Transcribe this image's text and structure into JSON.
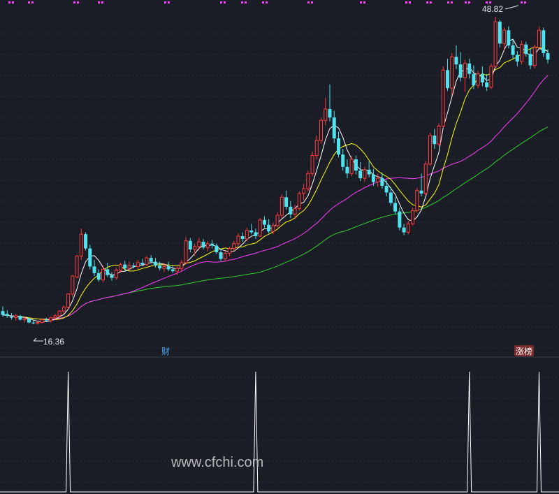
{
  "chart_data": [
    {
      "type": "candlestick",
      "price_range": [
        14.5,
        50.0
      ],
      "annotations": {
        "high_label": "48.82",
        "low_label": "16.36"
      },
      "event_markers": [
        {
          "label": "财",
          "index": 40
        },
        {
          "label": "涨榜",
          "index": 125
        }
      ],
      "colors": {
        "up": "#ff3b3b",
        "down": "#4fe3f0",
        "ma5": "#ffffff",
        "ma10": "#ffff00",
        "ma30": "#ff3cff",
        "ma60": "#2ed12e",
        "dots": "#ff3cff",
        "grid": "#2e3440"
      },
      "candles": [
        {
          "o": 17.8,
          "h": 18.3,
          "l": 17.2,
          "c": 17.4
        },
        {
          "o": 17.5,
          "h": 17.9,
          "l": 17.1,
          "c": 17.3
        },
        {
          "o": 17.2,
          "h": 17.6,
          "l": 16.9,
          "c": 17.1
        },
        {
          "o": 17.1,
          "h": 17.5,
          "l": 16.8,
          "c": 17.3
        },
        {
          "o": 17.3,
          "h": 17.4,
          "l": 16.8,
          "c": 16.9
        },
        {
          "o": 16.9,
          "h": 17.2,
          "l": 16.6,
          "c": 17.0
        },
        {
          "o": 17.0,
          "h": 17.1,
          "l": 16.5,
          "c": 16.6
        },
        {
          "o": 16.6,
          "h": 16.9,
          "l": 16.4,
          "c": 16.5
        },
        {
          "o": 16.5,
          "h": 16.8,
          "l": 16.36,
          "c": 16.6
        },
        {
          "o": 16.6,
          "h": 17.0,
          "l": 16.5,
          "c": 16.9
        },
        {
          "o": 16.9,
          "h": 17.1,
          "l": 16.7,
          "c": 16.8
        },
        {
          "o": 16.8,
          "h": 17.2,
          "l": 16.6,
          "c": 17.1
        },
        {
          "o": 17.1,
          "h": 17.5,
          "l": 16.9,
          "c": 17.3
        },
        {
          "o": 17.3,
          "h": 17.9,
          "l": 17.1,
          "c": 17.8
        },
        {
          "o": 17.8,
          "h": 18.4,
          "l": 17.5,
          "c": 18.2
        },
        {
          "o": 18.2,
          "h": 19.7,
          "l": 18.0,
          "c": 19.6
        },
        {
          "o": 19.6,
          "h": 21.6,
          "l": 19.3,
          "c": 21.5
        },
        {
          "o": 21.4,
          "h": 23.7,
          "l": 21.2,
          "c": 23.6
        },
        {
          "o": 23.6,
          "h": 26.5,
          "l": 23.2,
          "c": 25.9
        },
        {
          "o": 25.9,
          "h": 26.1,
          "l": 24.2,
          "c": 24.4
        },
        {
          "o": 24.4,
          "h": 24.8,
          "l": 22.2,
          "c": 22.5
        },
        {
          "o": 22.5,
          "h": 23.2,
          "l": 21.5,
          "c": 21.8
        },
        {
          "o": 21.8,
          "h": 22.2,
          "l": 20.9,
          "c": 21.1
        },
        {
          "o": 21.1,
          "h": 22.6,
          "l": 20.8,
          "c": 22.2
        },
        {
          "o": 22.2,
          "h": 22.9,
          "l": 21.4,
          "c": 21.6
        },
        {
          "o": 21.6,
          "h": 21.9,
          "l": 21.0,
          "c": 21.3
        },
        {
          "o": 21.3,
          "h": 22.4,
          "l": 21.1,
          "c": 22.1
        },
        {
          "o": 22.1,
          "h": 22.9,
          "l": 21.8,
          "c": 22.7
        },
        {
          "o": 22.7,
          "h": 23.1,
          "l": 22.0,
          "c": 22.3
        },
        {
          "o": 22.3,
          "h": 23.0,
          "l": 22.1,
          "c": 22.6
        },
        {
          "o": 22.6,
          "h": 22.9,
          "l": 22.3,
          "c": 22.5
        },
        {
          "o": 22.5,
          "h": 23.2,
          "l": 22.2,
          "c": 22.9
        },
        {
          "o": 22.9,
          "h": 23.3,
          "l": 22.6,
          "c": 22.7
        },
        {
          "o": 22.7,
          "h": 23.6,
          "l": 22.5,
          "c": 23.4
        },
        {
          "o": 23.4,
          "h": 23.7,
          "l": 22.9,
          "c": 23.0
        },
        {
          "o": 23.0,
          "h": 23.4,
          "l": 22.4,
          "c": 22.6
        },
        {
          "o": 22.6,
          "h": 23.0,
          "l": 22.1,
          "c": 22.3
        },
        {
          "o": 22.3,
          "h": 22.8,
          "l": 21.9,
          "c": 22.5
        },
        {
          "o": 22.5,
          "h": 23.0,
          "l": 22.0,
          "c": 22.2
        },
        {
          "o": 22.2,
          "h": 22.6,
          "l": 21.8,
          "c": 22.0
        },
        {
          "o": 22.0,
          "h": 22.5,
          "l": 21.6,
          "c": 22.3
        },
        {
          "o": 22.3,
          "h": 23.2,
          "l": 22.0,
          "c": 22.9
        },
        {
          "o": 22.9,
          "h": 25.6,
          "l": 22.7,
          "c": 25.2
        },
        {
          "o": 25.2,
          "h": 25.5,
          "l": 24.0,
          "c": 24.3
        },
        {
          "o": 24.3,
          "h": 24.9,
          "l": 23.6,
          "c": 24.6
        },
        {
          "o": 24.6,
          "h": 25.5,
          "l": 24.2,
          "c": 25.1
        },
        {
          "o": 25.1,
          "h": 25.4,
          "l": 24.3,
          "c": 24.5
        },
        {
          "o": 24.5,
          "h": 25.2,
          "l": 24.1,
          "c": 24.9
        },
        {
          "o": 24.9,
          "h": 25.3,
          "l": 24.4,
          "c": 24.7
        },
        {
          "o": 24.7,
          "h": 24.9,
          "l": 23.8,
          "c": 24.0
        },
        {
          "o": 24.0,
          "h": 24.4,
          "l": 23.1,
          "c": 23.3
        },
        {
          "o": 23.3,
          "h": 24.2,
          "l": 23.0,
          "c": 23.9
        },
        {
          "o": 23.9,
          "h": 24.6,
          "l": 23.6,
          "c": 24.4
        },
        {
          "o": 24.4,
          "h": 25.2,
          "l": 24.1,
          "c": 24.9
        },
        {
          "o": 24.9,
          "h": 26.0,
          "l": 24.6,
          "c": 25.7
        },
        {
          "o": 25.7,
          "h": 26.1,
          "l": 25.1,
          "c": 25.4
        },
        {
          "o": 25.4,
          "h": 26.6,
          "l": 25.2,
          "c": 26.3
        },
        {
          "o": 26.3,
          "h": 27.0,
          "l": 25.9,
          "c": 26.1
        },
        {
          "o": 26.1,
          "h": 26.5,
          "l": 25.4,
          "c": 25.7
        },
        {
          "o": 25.7,
          "h": 27.6,
          "l": 25.6,
          "c": 27.4
        },
        {
          "o": 27.4,
          "h": 27.8,
          "l": 26.6,
          "c": 26.9
        },
        {
          "o": 26.9,
          "h": 27.5,
          "l": 26.0,
          "c": 26.2
        },
        {
          "o": 26.2,
          "h": 27.1,
          "l": 25.9,
          "c": 26.8
        },
        {
          "o": 26.8,
          "h": 28.2,
          "l": 26.6,
          "c": 27.9
        },
        {
          "o": 27.9,
          "h": 30.1,
          "l": 27.6,
          "c": 29.8
        },
        {
          "o": 29.8,
          "h": 30.5,
          "l": 28.5,
          "c": 28.8
        },
        {
          "o": 28.8,
          "h": 29.4,
          "l": 27.6,
          "c": 28.0
        },
        {
          "o": 28.0,
          "h": 29.0,
          "l": 27.5,
          "c": 28.6
        },
        {
          "o": 28.6,
          "h": 30.4,
          "l": 28.4,
          "c": 30.2
        },
        {
          "o": 30.2,
          "h": 31.2,
          "l": 29.5,
          "c": 30.7
        },
        {
          "o": 30.7,
          "h": 32.6,
          "l": 30.4,
          "c": 32.3
        },
        {
          "o": 32.3,
          "h": 34.6,
          "l": 32.0,
          "c": 34.2
        },
        {
          "o": 34.2,
          "h": 36.3,
          "l": 33.8,
          "c": 35.8
        },
        {
          "o": 35.8,
          "h": 38.2,
          "l": 35.4,
          "c": 37.9
        },
        {
          "o": 37.9,
          "h": 40.3,
          "l": 37.4,
          "c": 39.1
        },
        {
          "o": 39.1,
          "h": 41.7,
          "l": 37.8,
          "c": 38.2
        },
        {
          "o": 38.2,
          "h": 38.9,
          "l": 35.5,
          "c": 36.0
        },
        {
          "o": 36.0,
          "h": 36.7,
          "l": 34.0,
          "c": 34.3
        },
        {
          "o": 34.3,
          "h": 34.9,
          "l": 32.6,
          "c": 33.0
        },
        {
          "o": 33.0,
          "h": 33.8,
          "l": 31.8,
          "c": 32.3
        },
        {
          "o": 32.3,
          "h": 34.1,
          "l": 32.0,
          "c": 33.8
        },
        {
          "o": 33.8,
          "h": 34.2,
          "l": 32.2,
          "c": 32.6
        },
        {
          "o": 32.6,
          "h": 33.5,
          "l": 31.5,
          "c": 31.8
        },
        {
          "o": 31.8,
          "h": 33.0,
          "l": 31.4,
          "c": 32.7
        },
        {
          "o": 32.7,
          "h": 33.6,
          "l": 31.9,
          "c": 32.2
        },
        {
          "o": 32.2,
          "h": 32.8,
          "l": 31.0,
          "c": 31.4
        },
        {
          "o": 31.4,
          "h": 32.3,
          "l": 30.9,
          "c": 31.8
        },
        {
          "o": 31.8,
          "h": 32.4,
          "l": 30.7,
          "c": 31.0
        },
        {
          "o": 31.0,
          "h": 31.6,
          "l": 29.9,
          "c": 30.3
        },
        {
          "o": 30.3,
          "h": 30.9,
          "l": 28.9,
          "c": 29.2
        },
        {
          "o": 29.2,
          "h": 29.8,
          "l": 28.0,
          "c": 28.3
        },
        {
          "o": 28.3,
          "h": 28.7,
          "l": 26.3,
          "c": 26.6
        },
        {
          "o": 26.6,
          "h": 27.0,
          "l": 25.8,
          "c": 26.1
        },
        {
          "o": 26.1,
          "h": 27.3,
          "l": 25.9,
          "c": 27.0
        },
        {
          "o": 27.0,
          "h": 28.7,
          "l": 26.8,
          "c": 28.4
        },
        {
          "o": 28.4,
          "h": 30.8,
          "l": 28.2,
          "c": 30.5
        },
        {
          "o": 30.5,
          "h": 32.3,
          "l": 29.9,
          "c": 30.2
        },
        {
          "o": 30.2,
          "h": 33.6,
          "l": 30.0,
          "c": 33.3
        },
        {
          "o": 33.3,
          "h": 36.6,
          "l": 33.1,
          "c": 36.3
        },
        {
          "o": 36.3,
          "h": 37.0,
          "l": 34.9,
          "c": 35.4
        },
        {
          "o": 35.4,
          "h": 37.6,
          "l": 35.2,
          "c": 37.3
        },
        {
          "o": 37.3,
          "h": 43.6,
          "l": 37.1,
          "c": 43.2
        },
        {
          "o": 43.2,
          "h": 44.4,
          "l": 41.0,
          "c": 41.3
        },
        {
          "o": 41.3,
          "h": 45.0,
          "l": 40.5,
          "c": 44.6
        },
        {
          "o": 44.6,
          "h": 45.8,
          "l": 43.3,
          "c": 43.8
        },
        {
          "o": 43.8,
          "h": 45.1,
          "l": 42.0,
          "c": 42.4
        },
        {
          "o": 42.4,
          "h": 44.3,
          "l": 40.9,
          "c": 43.9
        },
        {
          "o": 43.9,
          "h": 44.4,
          "l": 42.3,
          "c": 42.8
        },
        {
          "o": 42.8,
          "h": 43.7,
          "l": 41.2,
          "c": 41.6
        },
        {
          "o": 41.6,
          "h": 43.1,
          "l": 41.3,
          "c": 42.8
        },
        {
          "o": 42.8,
          "h": 43.6,
          "l": 41.5,
          "c": 41.9
        },
        {
          "o": 41.9,
          "h": 42.8,
          "l": 41.0,
          "c": 41.4
        },
        {
          "o": 41.4,
          "h": 43.9,
          "l": 41.2,
          "c": 43.6
        },
        {
          "o": 43.6,
          "h": 48.82,
          "l": 43.4,
          "c": 48.3
        },
        {
          "o": 48.3,
          "h": 48.5,
          "l": 45.6,
          "c": 46.0
        },
        {
          "o": 46.0,
          "h": 47.7,
          "l": 45.3,
          "c": 47.4
        },
        {
          "o": 47.4,
          "h": 47.8,
          "l": 45.5,
          "c": 45.8
        },
        {
          "o": 45.8,
          "h": 46.5,
          "l": 44.4,
          "c": 44.8
        },
        {
          "o": 44.8,
          "h": 45.2,
          "l": 43.6,
          "c": 44.1
        },
        {
          "o": 44.1,
          "h": 46.3,
          "l": 43.8,
          "c": 45.9
        },
        {
          "o": 45.9,
          "h": 46.2,
          "l": 44.6,
          "c": 44.9
        },
        {
          "o": 44.9,
          "h": 45.5,
          "l": 43.3,
          "c": 43.7
        },
        {
          "o": 43.7,
          "h": 45.9,
          "l": 43.4,
          "c": 45.6
        },
        {
          "o": 45.6,
          "h": 47.8,
          "l": 45.3,
          "c": 47.4
        },
        {
          "o": 47.4,
          "h": 47.7,
          "l": 44.6,
          "c": 45.0
        },
        {
          "o": 45.0,
          "h": 45.4,
          "l": 43.9,
          "c": 44.3
        }
      ]
    },
    {
      "type": "line",
      "indicator": "signal",
      "values": [
        0,
        0,
        0,
        0,
        0,
        0,
        0,
        0,
        0,
        0,
        0,
        0,
        0,
        0,
        0,
        1,
        0,
        0,
        0,
        0,
        0,
        0,
        0,
        0,
        0,
        0,
        0,
        0,
        0,
        0,
        0,
        0,
        0,
        0,
        0,
        0,
        0,
        0,
        0,
        0,
        0,
        0,
        0,
        0,
        0,
        0,
        0,
        0,
        0,
        0,
        0,
        0,
        0,
        0,
        0,
        0,
        0,
        0,
        1,
        0,
        0,
        0,
        0,
        0,
        0,
        0,
        0,
        0,
        0,
        0,
        0,
        0,
        0,
        0,
        0,
        0,
        0,
        0,
        0,
        0,
        0,
        0,
        0,
        0,
        0,
        0,
        0,
        0,
        0,
        0,
        0,
        0,
        0,
        0,
        0,
        0,
        0,
        0,
        0,
        0,
        0,
        0,
        0,
        0,
        0,
        0,
        0,
        1,
        0,
        0,
        0,
        0,
        0,
        0,
        0,
        0,
        0,
        0,
        0,
        0,
        0,
        0,
        0,
        1,
        0,
        0,
        0,
        0,
        0,
        0,
        0
      ],
      "color": "#ffffff"
    }
  ],
  "watermark": "www.cfchi.com"
}
